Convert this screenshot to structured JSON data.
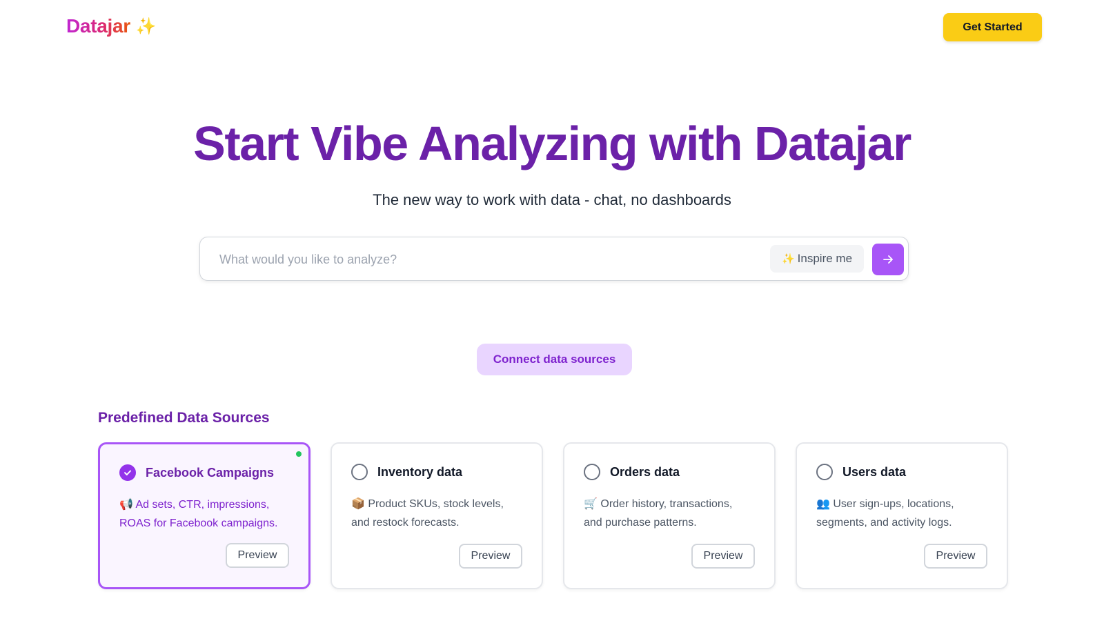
{
  "brand": {
    "name": "Datajar",
    "sparkle": "✨"
  },
  "header": {
    "cta_label": "Get Started"
  },
  "hero": {
    "title": "Start Vibe Analyzing with Datajar",
    "subtitle": "The new way to work with data - chat, no dashboards"
  },
  "search": {
    "placeholder": "What would you like to analyze?",
    "value": "",
    "inspire_label": "Inspire me",
    "inspire_icon": "✨"
  },
  "connect_label": "Connect data sources",
  "sources": {
    "title": "Predefined Data Sources",
    "preview_label": "Preview",
    "items": [
      {
        "title": "Facebook Campaigns",
        "icon": "📢",
        "description": "Ad sets, CTR, impressions, ROAS for Facebook campaigns.",
        "selected": true
      },
      {
        "title": "Inventory data",
        "icon": "📦",
        "description": "Product SKUs, stock levels, and restock forecasts.",
        "selected": false
      },
      {
        "title": "Orders data",
        "icon": "🛒",
        "description": "Order history, transactions, and purchase patterns.",
        "selected": false
      },
      {
        "title": "Users data",
        "icon": "👥",
        "description": "User sign-ups, locations, segments, and activity logs.",
        "selected": false
      }
    ]
  },
  "colors": {
    "brand_purple": "#6b21a8",
    "accent_purple": "#a855f7",
    "cta_yellow": "#facc15",
    "status_green": "#22c55e"
  }
}
